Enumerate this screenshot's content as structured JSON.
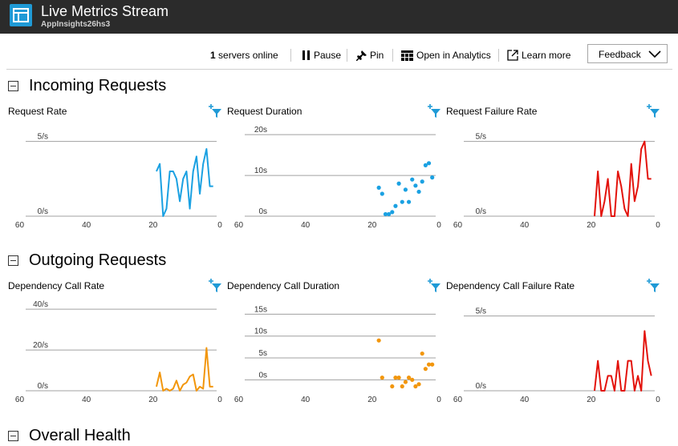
{
  "app": {
    "title": "Live Metrics Stream",
    "subtitle": "AppInsights26hs3"
  },
  "toolbar": {
    "servers_count": "1",
    "servers_label": "servers online",
    "pause_label": "Pause",
    "pin_label": "Pin",
    "analytics_label": "Open in Analytics",
    "learn_label": "Learn more",
    "feedback_label": "Feedback"
  },
  "sections": {
    "incoming": "Incoming Requests",
    "outgoing": "Outgoing Requests",
    "health": "Overall Health"
  },
  "charts": {
    "request_rate": "Request Rate",
    "request_duration": "Request Duration",
    "request_failure_rate": "Request Failure Rate",
    "dependency_call_rate": "Dependency Call Rate",
    "dependency_call_duration": "Dependency Call Duration",
    "dependency_call_failure_rate": "Dependency Call Failure Rate"
  },
  "colors": {
    "blue": "#1ba1e2",
    "orange": "#f2960c",
    "red": "#e3130c",
    "accent": "#1f9ad6"
  },
  "chart_data": [
    {
      "id": "request_rate",
      "type": "line",
      "color": "#1ba1e2",
      "x": [
        19,
        18,
        17,
        16,
        15,
        14,
        13,
        12,
        11,
        10,
        9,
        8,
        7,
        6,
        5,
        4,
        3,
        2
      ],
      "values": [
        3.0,
        3.5,
        0,
        0.5,
        3,
        3,
        2.5,
        1,
        2.5,
        3,
        0.5,
        3,
        4,
        1.5,
        3.5,
        4.5,
        2,
        2
      ],
      "xlim": [
        63,
        0
      ],
      "xticks": [
        60,
        40,
        20,
        0
      ],
      "ylim": [
        0,
        6
      ],
      "gridlines": [
        5,
        0
      ],
      "ytick_labels": [
        "5/s",
        "0/s"
      ]
    },
    {
      "id": "request_duration",
      "type": "scatter",
      "color": "#1ba1e2",
      "x": [
        18,
        17,
        16,
        15,
        14,
        13,
        12,
        11,
        10,
        9,
        8,
        7,
        6,
        5,
        4,
        3,
        2
      ],
      "values": [
        7,
        5.5,
        0.5,
        0.5,
        1,
        2.5,
        8,
        3.5,
        6.5,
        3.5,
        9,
        7.5,
        6,
        8.5,
        12.5,
        13,
        9.5
      ],
      "xlim": [
        63,
        0
      ],
      "xticks": [
        60,
        40,
        20,
        0
      ],
      "ylim": [
        0,
        22
      ],
      "gridlines": [
        20,
        10,
        0
      ],
      "ytick_labels": [
        "20s",
        "10s",
        "0s"
      ]
    },
    {
      "id": "request_failure_rate",
      "type": "line",
      "color": "#e3130c",
      "x": [
        19,
        18,
        17,
        16,
        15,
        14,
        13,
        12,
        11,
        10,
        9,
        8,
        7,
        6,
        5,
        4,
        3,
        2
      ],
      "values": [
        0,
        3,
        0,
        1,
        2.5,
        0,
        0,
        3,
        2,
        0.5,
        0,
        3.5,
        1,
        2,
        4.5,
        5,
        2.5,
        2.5
      ],
      "xlim": [
        63,
        0
      ],
      "xticks": [
        60,
        40,
        20,
        0
      ],
      "ylim": [
        0,
        6
      ],
      "gridlines": [
        5,
        0
      ],
      "ytick_labels": [
        "5/s",
        "0/s"
      ]
    },
    {
      "id": "dependency_call_rate",
      "type": "line",
      "color": "#f2960c",
      "x": [
        19,
        18,
        17,
        16,
        15,
        14,
        13,
        12,
        11,
        10,
        9,
        8,
        7,
        6,
        5,
        4,
        3,
        2
      ],
      "values": [
        2,
        9,
        0,
        1,
        0,
        1,
        5,
        0,
        3,
        4,
        7,
        8,
        0,
        2,
        1,
        21,
        2,
        2
      ],
      "xlim": [
        63,
        0
      ],
      "xticks": [
        60,
        40,
        20,
        0
      ],
      "ylim": [
        0,
        44
      ],
      "gridlines": [
        40,
        20,
        0
      ],
      "ytick_labels": [
        "40/s",
        "20/s",
        "0/s"
      ]
    },
    {
      "id": "dependency_call_duration",
      "type": "scatter",
      "color": "#f2960c",
      "x": [
        18,
        17,
        14,
        13,
        12,
        11,
        10,
        9,
        8,
        7,
        6,
        5,
        4,
        3,
        2
      ],
      "values": [
        9,
        0.5,
        -1.5,
        0.5,
        0.5,
        -1.5,
        -0.5,
        0.5,
        0,
        -1.5,
        -1,
        6,
        2.5,
        3.5,
        3.5
      ],
      "xlim": [
        63,
        0
      ],
      "xticks": [
        60,
        40,
        20,
        0
      ],
      "ylim": [
        -2.5,
        18
      ],
      "gridlines": [
        15,
        10,
        5,
        0
      ],
      "ytick_labels": [
        "15s",
        "10s",
        "5s",
        "0s"
      ]
    },
    {
      "id": "dependency_call_failure_rate",
      "type": "line",
      "color": "#e3130c",
      "x": [
        19,
        18,
        17,
        16,
        15,
        14,
        13,
        12,
        11,
        10,
        9,
        8,
        7,
        6,
        5,
        4,
        3,
        2
      ],
      "values": [
        0,
        2,
        0,
        0,
        1,
        1,
        0,
        2,
        0,
        0,
        2,
        2,
        0,
        1,
        0,
        4,
        2,
        1
      ],
      "xlim": [
        63,
        0
      ],
      "xticks": [
        60,
        40,
        20,
        0
      ],
      "ylim": [
        0,
        6
      ],
      "gridlines": [
        5,
        0
      ],
      "ytick_labels": [
        "5/s",
        "0/s"
      ]
    }
  ]
}
